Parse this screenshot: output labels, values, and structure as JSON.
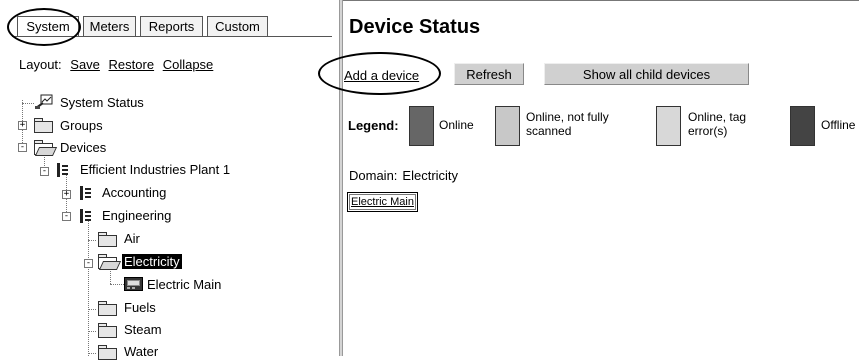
{
  "tabs": [
    {
      "label": "System",
      "active": true
    },
    {
      "label": "Meters",
      "active": false
    },
    {
      "label": "Reports",
      "active": false
    },
    {
      "label": "Custom",
      "active": false
    }
  ],
  "layout": {
    "label": "Layout:",
    "save": "Save",
    "restore": "Restore",
    "collapse": "Collapse"
  },
  "tree": {
    "system_status": "System Status",
    "groups": "Groups",
    "devices": "Devices",
    "plant": "Efficient Industries Plant 1",
    "accounting": "Accounting",
    "engineering": "Engineering",
    "air": "Air",
    "electricity": "Electricity",
    "electric_main": "Electric Main",
    "fuels": "Fuels",
    "steam": "Steam",
    "water": "Water"
  },
  "main": {
    "title": "Device Status",
    "add_device": "Add a device",
    "refresh": "Refresh",
    "show_children": "Show all child devices",
    "legend_label": "Legend:",
    "legend": [
      {
        "text": "Online",
        "color": "#666666"
      },
      {
        "text": "Online, not fully scanned",
        "color": "#c8c8c8"
      },
      {
        "text": "Online, tag error(s)",
        "color": "#d8d8d8"
      },
      {
        "text": "Offline",
        "color": "#444444"
      }
    ],
    "domain_label": "Domain:",
    "domain_value": "Electricity",
    "device_chip": "Electric Main"
  },
  "colors": {
    "tab_border": "#555555",
    "divider": "#d4d4d4",
    "button_bg": "#d0d0d0",
    "selection_bg": "#000000"
  }
}
